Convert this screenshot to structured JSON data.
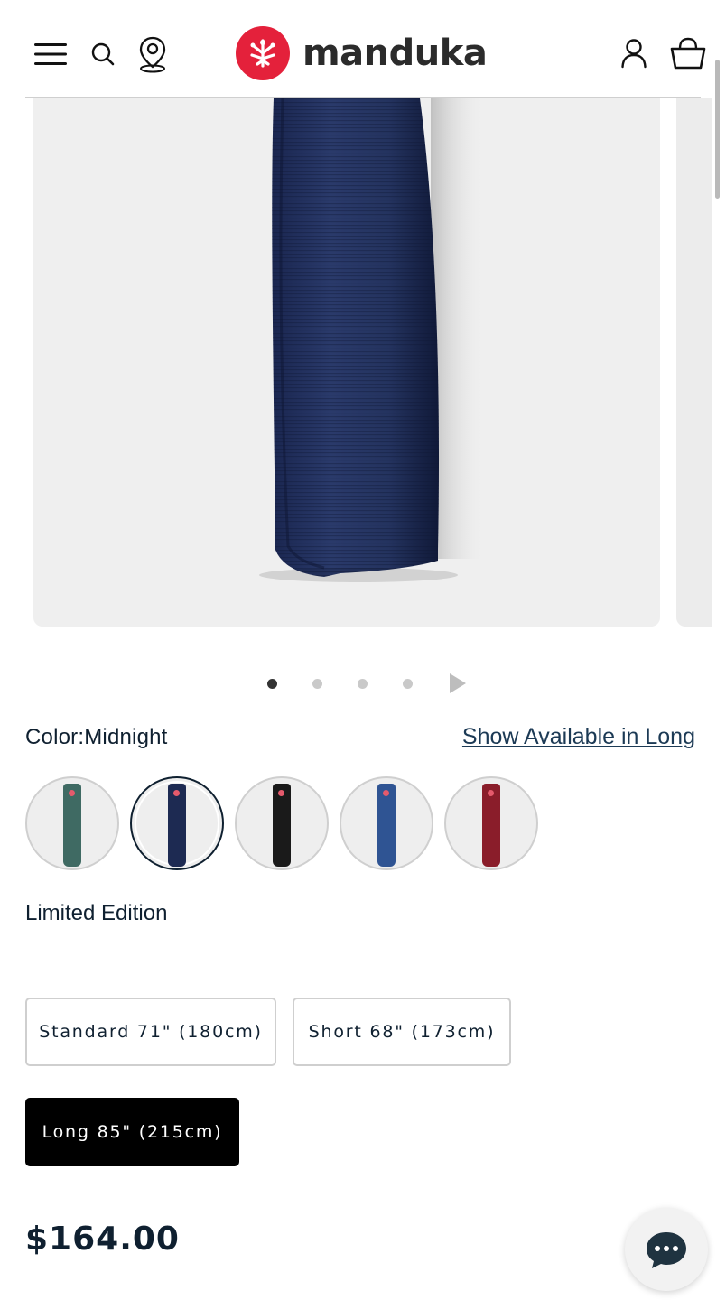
{
  "header": {
    "brand": "manduka",
    "icons": [
      "menu-icon",
      "search-icon",
      "store-locator-icon",
      "account-icon",
      "cart-icon"
    ]
  },
  "gallery": {
    "slide_count": 4,
    "active_slide": 1
  },
  "product": {
    "color_label": "Color:Midnight",
    "show_available_link": "Show Available in Long",
    "swatches": [
      {
        "name": "Green",
        "color": "#3f6a63",
        "selected": false
      },
      {
        "name": "Midnight",
        "color": "#1d2a52",
        "selected": true
      },
      {
        "name": "Black",
        "color": "#1a1a1a",
        "selected": false
      },
      {
        "name": "Blue",
        "color": "#2f5493",
        "selected": false
      },
      {
        "name": "Red",
        "color": "#8a1d2a",
        "selected": false
      }
    ],
    "edition_label": "Limited Edition",
    "sizes": [
      {
        "label": "Standard 71\" (180cm)",
        "selected": false
      },
      {
        "label": "Short 68\" (173cm)",
        "selected": false
      },
      {
        "label": "Long 85\" (215cm)",
        "selected": true
      }
    ],
    "price": "$164.00"
  },
  "colors": {
    "brand_red": "#e4213b",
    "text_navy": "#0f2030",
    "mat_midnight": "#1f2c55"
  }
}
